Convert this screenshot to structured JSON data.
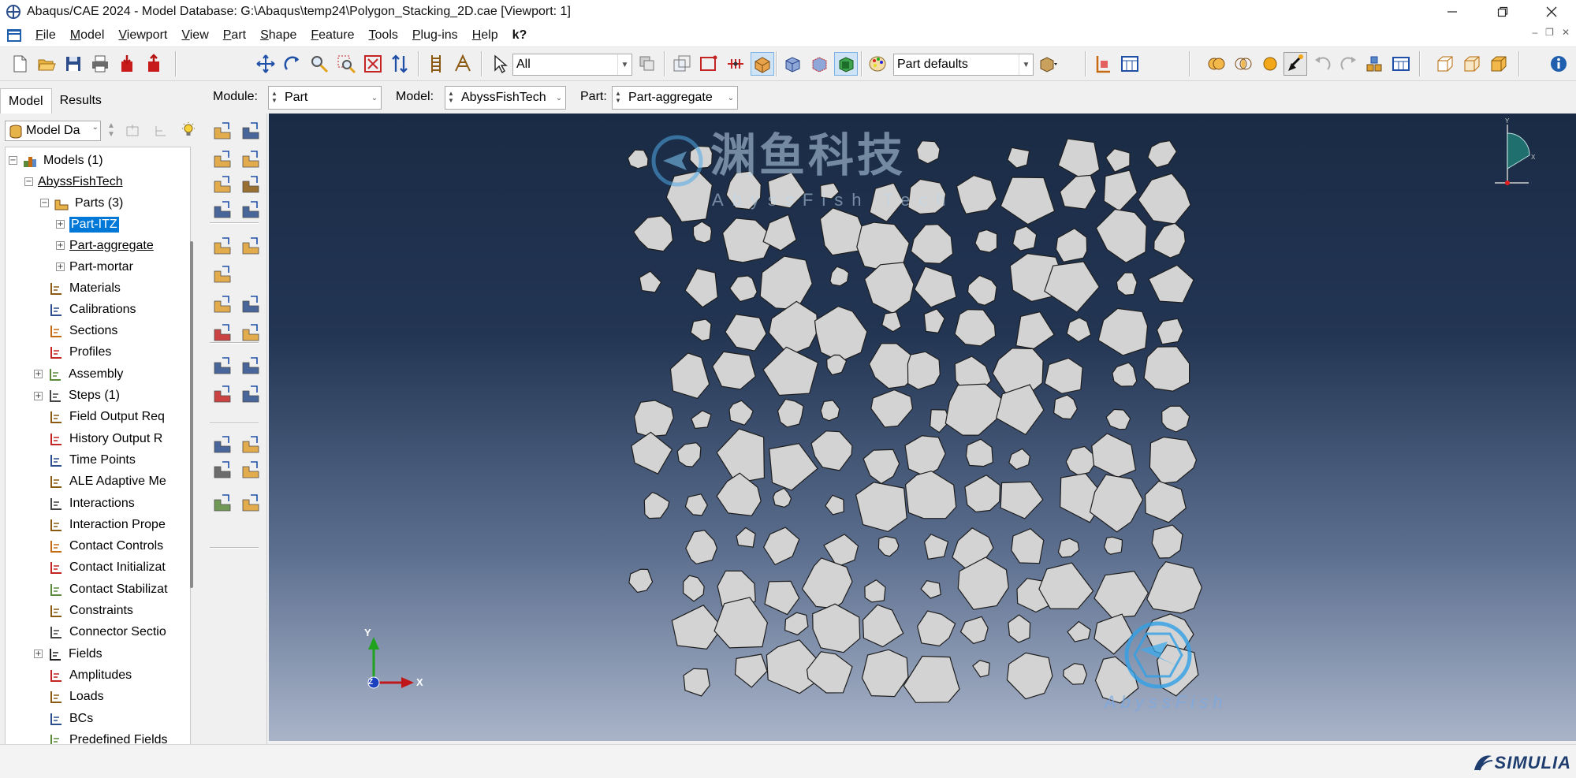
{
  "window": {
    "title": "Abaqus/CAE 2024 - Model Database: G:\\Abaqus\\temp24\\Polygon_Stacking_2D.cae [Viewport: 1]",
    "controls": [
      "minimize",
      "restore",
      "close"
    ]
  },
  "menubar": {
    "items": [
      {
        "label": "File",
        "key": "F",
        "rest": "ile"
      },
      {
        "label": "Model",
        "key": "M",
        "rest": "odel"
      },
      {
        "label": "Viewport",
        "key": "V",
        "rest": "iewport"
      },
      {
        "label": "View",
        "key": "V",
        "rest": "iew"
      },
      {
        "label": "Part",
        "key": "P",
        "rest": "art"
      },
      {
        "label": "Shape",
        "key": "S",
        "rest": "hape"
      },
      {
        "label": "Feature",
        "key": "F",
        "rest": "eature"
      },
      {
        "label": "Tools",
        "key": "T",
        "rest": "ools"
      },
      {
        "label": "Plug-ins",
        "key": "P",
        "rest": "lug-ins"
      },
      {
        "label": "Help",
        "key": "H",
        "rest": "elp"
      }
    ],
    "whats_this": "k?"
  },
  "toolbar": {
    "selection_filter": "All",
    "render_style": "Part defaults"
  },
  "leftpanel": {
    "tabs": [
      "Model",
      "Results"
    ],
    "model_combo": "Model Da",
    "tree": {
      "models_root": "Models (1)",
      "model_name": "AbyssFishTech",
      "parts": "Parts (3)",
      "part_items": [
        "Part-ITZ",
        "Part-aggregate",
        "Part-mortar"
      ],
      "items": [
        {
          "label": "Materials",
          "icon": "materials-icon"
        },
        {
          "label": "Calibrations",
          "icon": "calibrations-icon"
        },
        {
          "label": "Sections",
          "icon": "sections-icon"
        },
        {
          "label": "Profiles",
          "icon": "profiles-icon"
        },
        {
          "label": "Assembly",
          "icon": "assembly-icon"
        },
        {
          "label": "Steps (1)",
          "icon": "steps-icon"
        },
        {
          "label": "Field Output Req",
          "icon": "field-output-icon"
        },
        {
          "label": "History Output R",
          "icon": "history-output-icon"
        },
        {
          "label": "Time Points",
          "icon": "time-points-icon"
        },
        {
          "label": "ALE Adaptive Me",
          "icon": "ale-adaptive-icon"
        },
        {
          "label": "Interactions",
          "icon": "interactions-icon"
        },
        {
          "label": "Interaction Prope",
          "icon": "interaction-properties-icon"
        },
        {
          "label": "Contact Controls",
          "icon": "contact-controls-icon"
        },
        {
          "label": "Contact Initializat",
          "icon": "contact-initialization-icon"
        },
        {
          "label": "Contact Stabilizat",
          "icon": "contact-stabilization-icon"
        },
        {
          "label": "Constraints",
          "icon": "constraints-icon"
        },
        {
          "label": "Connector Sectio",
          "icon": "connector-sections-icon"
        },
        {
          "label": "Fields",
          "icon": "fields-icon"
        },
        {
          "label": "Amplitudes",
          "icon": "amplitudes-icon"
        },
        {
          "label": "Loads",
          "icon": "loads-icon"
        },
        {
          "label": "BCs",
          "icon": "bcs-icon"
        },
        {
          "label": "Predefined Fields",
          "icon": "predefined-fields-icon"
        }
      ]
    }
  },
  "modulebar": {
    "module_label": "Module:",
    "module_value": "Part",
    "model_label": "Model:",
    "model_value": "AbyssFishTech",
    "part_label": "Part:",
    "part_value": "Part-aggregate"
  },
  "viewport": {
    "triad_labels": {
      "x": "X",
      "y": "Y",
      "z": "Z"
    },
    "watermark_cn": "渊鱼科技",
    "watermark_en": "AbyssFish Tech",
    "watermark_en2": "AbyssFish",
    "colors": {
      "bg_top": "#1a2b45",
      "bg_bottom": "#a9b4c9",
      "aggregate_fill": "#d3d3d3",
      "aggregate_stroke": "#1e1e1e",
      "axis_x": "#c0181a",
      "axis_y": "#1fa31f",
      "axis_z": "#1a3fbf"
    }
  },
  "statusbar": {
    "brand": "SIMULIA"
  }
}
